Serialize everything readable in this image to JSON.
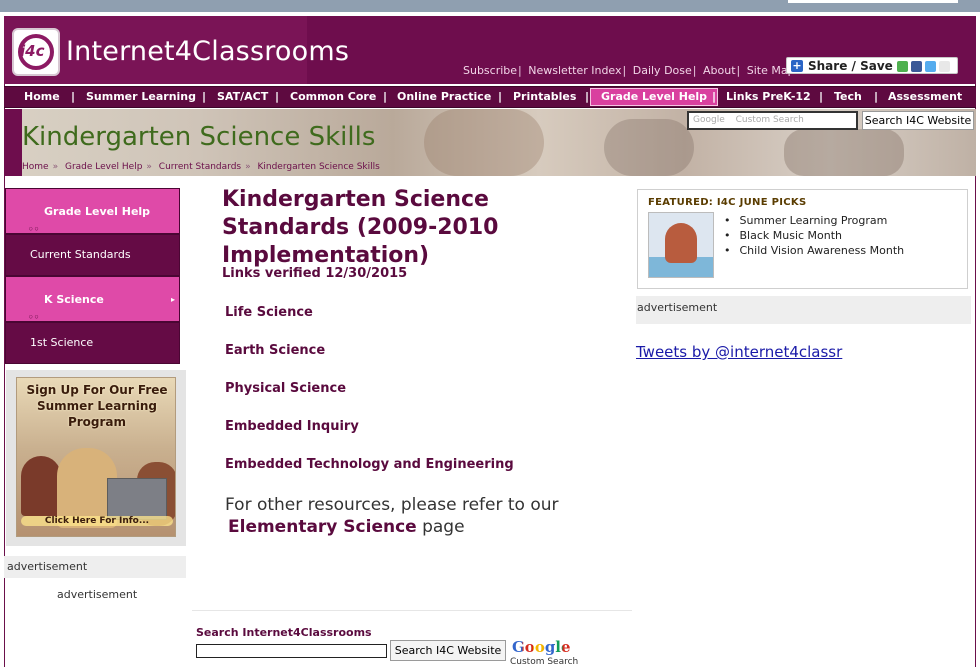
{
  "brand": {
    "logo_badge": "i4c",
    "name": "Internet4Classrooms"
  },
  "util_links": [
    "Subscribe",
    "Newsletter Index",
    "Daily Dose",
    "About",
    "Site Map"
  ],
  "share": {
    "label": "Share / Save"
  },
  "nav": [
    "Home",
    "Summer Learning",
    "SAT/ACT",
    "Common Core",
    "Online Practice",
    "Printables",
    "Grade Level Help",
    "Links PreK-12",
    "Tech",
    "Assessment"
  ],
  "nav_active": "Grade Level Help",
  "banner": {
    "title": "Kindergarten Science Skills",
    "breadcrumb": [
      "Home",
      "Grade Level Help",
      "Current Standards",
      "Kindergarten Science Skills"
    ],
    "search_placeholder": "Custom Search",
    "search_brand": "Google",
    "search_button": "Search I4C Website"
  },
  "sidebar": {
    "items": [
      {
        "label": "Grade Level Help",
        "style": "pink"
      },
      {
        "label": "Current Standards",
        "style": "dark"
      },
      {
        "label": "K Science",
        "style": "pink"
      },
      {
        "label": "1st Science",
        "style": "dark"
      }
    ],
    "promo": {
      "headline": "Sign Up For Our Free Summer Learning Program",
      "footer": "Click Here For Info..."
    },
    "ad_label": "advertisement",
    "ad_label2": "advertisement"
  },
  "main": {
    "title": "Kindergarten Science Standards (2009-2010 Implementation)",
    "verified": "Links verified 12/30/2015",
    "topics": [
      "Life Science",
      "Earth Science",
      "Physical Science",
      "Embedded Inquiry",
      "Embedded Technology and Engineering"
    ],
    "other_text": "For other resources, please refer to our",
    "other_link": "Elementary Science",
    "other_suffix": "page"
  },
  "bottom_search": {
    "label": "Search Internet4Classrooms",
    "button": "Search I4C Website",
    "google": "Google",
    "google_sub": "Custom Search"
  },
  "featured": {
    "title": "FEATURED: I4C JUNE PICKS",
    "items": [
      "Summer Learning Program",
      "Black Music Month",
      "Child Vision Awareness Month"
    ]
  },
  "right_ad_label": "advertisement",
  "tweets_link": "Tweets by @internet4classr",
  "colors": {
    "brand": "#6e0d4d",
    "accent_pink": "#df4aa8",
    "title": "#5a0a3e",
    "banner_title": "#3f6b1d"
  }
}
